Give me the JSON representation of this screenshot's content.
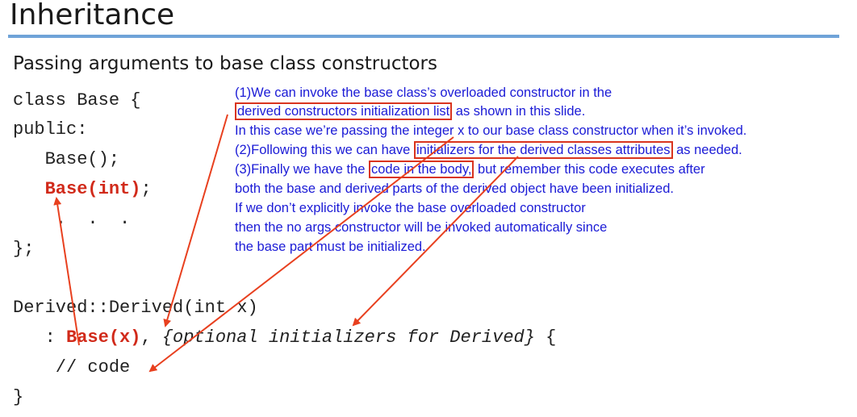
{
  "slide": {
    "title": "Inheritance",
    "subtitle": "Passing arguments to base class constructors"
  },
  "code": {
    "line1": "class Base {",
    "line2": "public:",
    "line3": "   Base();",
    "line4_indent": "   ",
    "line4_red": "Base(int)",
    "line4_end": ";",
    "line5": "    .  .  .",
    "line6": "};",
    "line7": "Derived::Derived(int x)",
    "line8_prefix": "   : ",
    "line8_red": "Base(x)",
    "line8_comma": ", ",
    "line8_italic": "{optional initializers for Derived}",
    "line8_end": " {",
    "line9": "    // code",
    "line10": "}"
  },
  "notes": {
    "n1": "(1)We can invoke the base class’s overloaded constructor in the",
    "n2_box": "derived constructors initialization list",
    "n2_rest": " as shown in this slide.",
    "n3": "In this case we’re passing the integer x to our base class constructor when it’s invoked.",
    "n4_pre": "(2)Following this we can have ",
    "n4_box": "initializers for the derived classes attributes",
    "n4_rest": " as needed.",
    "n5_pre": "(3)Finally we have the ",
    "n5_box": "code in the body,",
    "n5_rest": " but remember this code executes after",
    "n6": "both the base and derived parts of the derived object have been initialized.",
    "n7": "If we don’t explicitly invoke the base overloaded constructor",
    "n8": "then the no args constructor will be invoked automatically since",
    "n9": "the base part must be initialized."
  },
  "colors": {
    "title_rule": "#6fa3d8",
    "note_text": "#1b1bd6",
    "highlight": "#d12a1a",
    "arrow": "#e8401f"
  }
}
